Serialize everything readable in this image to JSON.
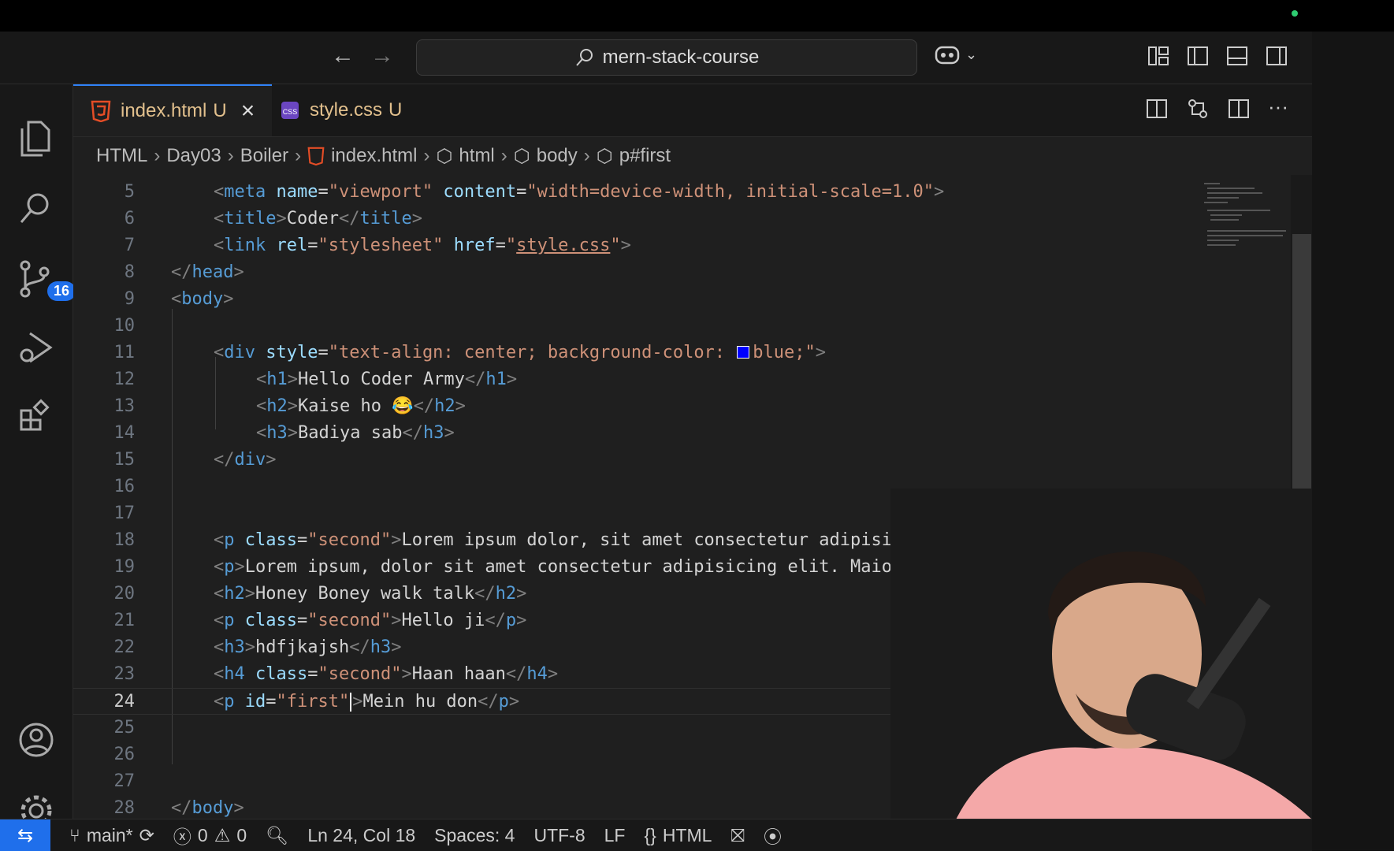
{
  "window": {
    "search_text": "mern-stack-course"
  },
  "activity": {
    "items": [
      "explorer-icon",
      "search-icon",
      "source-control-icon",
      "run-debug-icon",
      "extensions-icon"
    ],
    "scm_badge": "16",
    "bottom_items": [
      "account-icon",
      "settings-gear-icon"
    ]
  },
  "tabs": [
    {
      "name": "index.html",
      "status": "U",
      "icon": "html5-icon",
      "active": true
    },
    {
      "name": "style.css",
      "status": "U",
      "icon": "css-icon",
      "active": false
    }
  ],
  "breadcrumb": [
    "HTML",
    "Day03",
    "Boiler",
    "index.html",
    "html",
    "body",
    "p#first"
  ],
  "editor": {
    "current_line": 24,
    "lines": [
      {
        "n": "5"
      },
      {
        "n": "6"
      },
      {
        "n": "7"
      },
      {
        "n": "8"
      },
      {
        "n": "9"
      },
      {
        "n": "10"
      },
      {
        "n": "11"
      },
      {
        "n": "12"
      },
      {
        "n": "13"
      },
      {
        "n": "14"
      },
      {
        "n": "15"
      },
      {
        "n": "16"
      },
      {
        "n": "17"
      },
      {
        "n": "18"
      },
      {
        "n": "19"
      },
      {
        "n": "20"
      },
      {
        "n": "21"
      },
      {
        "n": "22"
      },
      {
        "n": "23"
      },
      {
        "n": "24"
      },
      {
        "n": "25"
      },
      {
        "n": "26"
      },
      {
        "n": "27"
      },
      {
        "n": "28"
      }
    ],
    "code": {
      "l5_attr1": "name",
      "l5_val1": "\"viewport\"",
      "l5_attr2": "content",
      "l5_val2": "\"width=device-width, initial-scale=1.0\"",
      "l6_text": "Coder",
      "l7_attr1": "rel",
      "l7_val1": "\"stylesheet\"",
      "l7_attr2": "href",
      "l7_val2": "style.css",
      "l11_val_a": "\"text-align: center; background-color: ",
      "l11_val_b": "blue;\"",
      "l12_text": "Hello Coder Army",
      "l13_text": "Kaise ho 😂",
      "l14_text": "Badiya sab",
      "l18_val": "\"second\"",
      "l18_text": "Lorem ipsum dolor, sit amet consectetur adipisicing elit. I",
      "l19_text": "Lorem ipsum, dolor sit amet consectetur adipisicing elit. Maiores, soluta",
      "l20_text": "Honey Boney walk talk",
      "l21_val": "\"second\"",
      "l21_text": "Hello ji",
      "l22_text": "hdfjkajsh",
      "l23_val": "\"second\"",
      "l23_text": "Haan haan",
      "l24_val": "\"first\"",
      "l24_text": "Mein hu don"
    }
  },
  "status": {
    "branch": "main*",
    "errors": "0",
    "warnings": "0",
    "position": "Ln 24, Col 18",
    "spaces": "Spaces: 4",
    "encoding": "UTF-8",
    "eol": "LF",
    "language": "HTML"
  },
  "colors": {
    "accent": "#1f6feb",
    "modified": "#e2c08d",
    "tag": "#569cd6",
    "attribute": "#9cdcfe",
    "string": "#ce9178"
  }
}
